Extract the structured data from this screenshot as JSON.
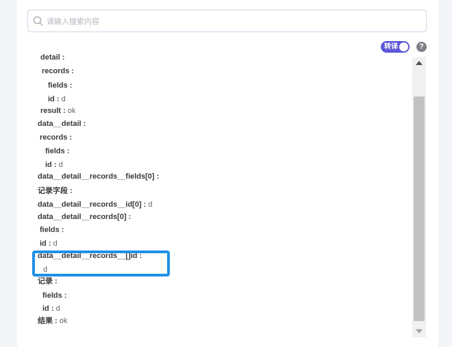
{
  "search": {
    "placeholder": "请输入搜索内容"
  },
  "toggle": {
    "label": "转译",
    "checked": true
  },
  "help": {
    "label": "?"
  },
  "tree": [
    {
      "key": "detail :",
      "value": ""
    },
    {
      "key": "records :",
      "value": ""
    },
    {
      "key": "fields :",
      "value": ""
    },
    {
      "key": "id :",
      "value": "d"
    },
    {
      "key": "result :",
      "value": "ok"
    },
    {
      "key": "data__detail :",
      "value": ""
    },
    {
      "key": "records :",
      "value": ""
    },
    {
      "key": "fields :",
      "value": ""
    },
    {
      "key": "id :",
      "value": "d"
    },
    {
      "key": "data__detail__records__fields[0] :",
      "value": ""
    },
    {
      "key": "记录字段 :",
      "value": ""
    },
    {
      "key": "data__detail__records__id[0] :",
      "value": "d"
    },
    {
      "key": "data__detail__records[0] :",
      "value": ""
    },
    {
      "key": "fields :",
      "value": ""
    },
    {
      "key": "id :",
      "value": "d"
    },
    {
      "key": "data__detail__records__[]id :",
      "value": ""
    },
    {
      "key": "",
      "value": "d"
    },
    {
      "key": "记录 :",
      "value": ""
    },
    {
      "key": "fields :",
      "value": ""
    },
    {
      "key": "id :",
      "value": "d"
    },
    {
      "key": "结果 :",
      "value": "ok"
    }
  ],
  "colors": {
    "accent": "#5b57d6",
    "highlight": "#1e90e6",
    "background": "#f4f5f9"
  }
}
